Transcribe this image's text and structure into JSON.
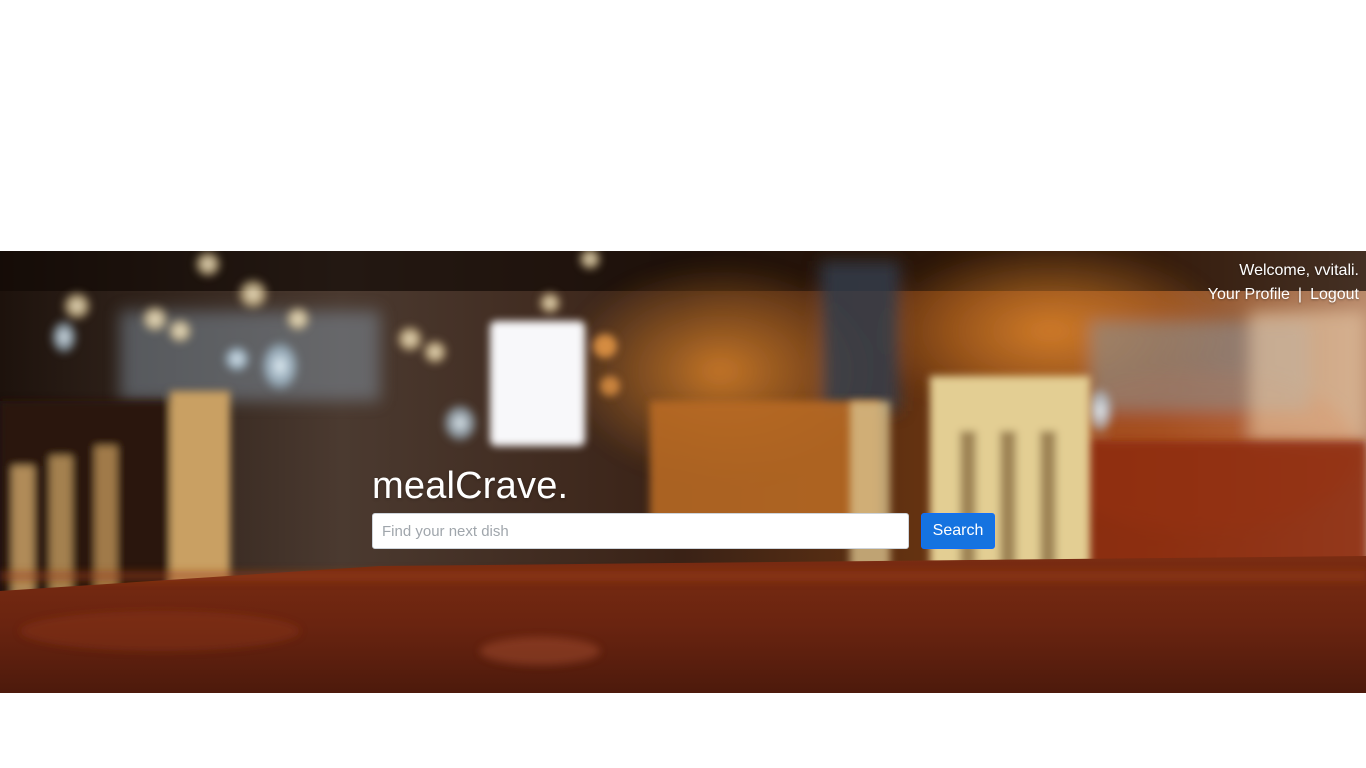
{
  "header": {
    "welcome_text": "Welcome, vvitali.",
    "profile_link": "Your Profile",
    "separator": "|",
    "logout_link": "Logout"
  },
  "hero": {
    "brand": "mealCrave.",
    "search": {
      "placeholder": "Find your next dish",
      "value": "",
      "button_label": "Search"
    }
  },
  "colors": {
    "accent": "#1573e0",
    "text_on_hero": "#ffffff",
    "page_background": "#ffffff"
  }
}
